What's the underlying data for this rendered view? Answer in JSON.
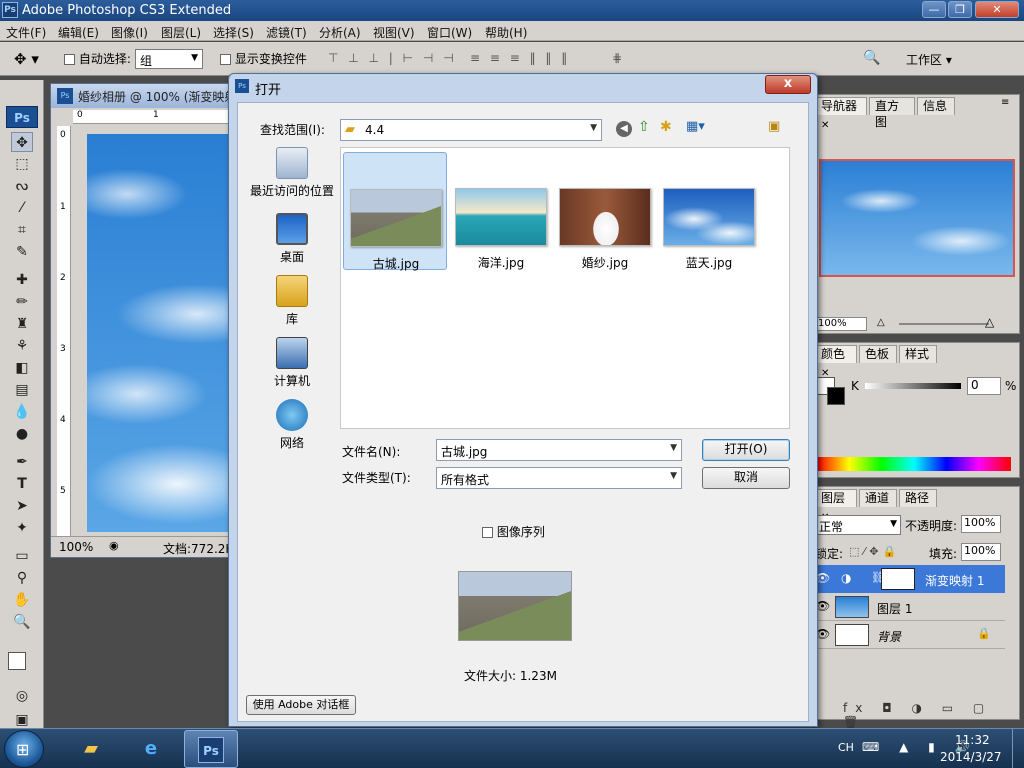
{
  "app": {
    "title": "Adobe Photoshop CS3 Extended",
    "ps_badge": "Ps"
  },
  "menu": [
    "文件(F)",
    "编辑(E)",
    "图像(I)",
    "图层(L)",
    "选择(S)",
    "滤镜(T)",
    "分析(A)",
    "视图(V)",
    "窗口(W)",
    "帮助(H)"
  ],
  "options_bar": {
    "auto_select_label": "自动选择:",
    "auto_select_value": "组",
    "show_transform_label": "显示变换控件",
    "workspace_label": "工作区 ▾"
  },
  "document": {
    "title": "婚纱相册 @ 100% (渐变映射",
    "zoom": "100%",
    "doc_size": "文档:772.2K",
    "ruler_top": [
      "0",
      "1"
    ],
    "ruler_left": [
      "0",
      "1",
      "2",
      "3",
      "4",
      "5"
    ]
  },
  "navigator_panel": {
    "tabs": [
      "导航器",
      "直方图",
      "信息"
    ],
    "zoom": "100%"
  },
  "color_panel": {
    "tabs": [
      "颜色",
      "色板",
      "样式"
    ],
    "channel": "K",
    "value": "0",
    "unit": "%"
  },
  "layers_panel": {
    "tabs": [
      "图层",
      "通道",
      "路径"
    ],
    "blend_mode": "正常",
    "opacity_label": "不透明度:",
    "opacity": "100%",
    "lock_label": "锁定:",
    "fill_label": "填充:",
    "fill": "100%",
    "layers": [
      {
        "name": "渐变映射 1",
        "selected": true
      },
      {
        "name": "图层 1",
        "selected": false
      },
      {
        "name": "背景",
        "selected": false
      }
    ]
  },
  "dialog": {
    "title": "打开",
    "look_in_label": "查找范围(I):",
    "look_in_value": "4.4",
    "places": [
      "最近访问的位置",
      "桌面",
      "库",
      "计算机",
      "网络"
    ],
    "files": [
      {
        "name": "古城.jpg",
        "selected": true
      },
      {
        "name": "海洋.jpg",
        "selected": false
      },
      {
        "name": "婚纱.jpg",
        "selected": false
      },
      {
        "name": "蓝天.jpg",
        "selected": false
      }
    ],
    "filename_label": "文件名(N):",
    "filename_value": "古城.jpg",
    "filetype_label": "文件类型(T):",
    "filetype_value": "所有格式",
    "open_button": "打开(O)",
    "cancel_button": "取消",
    "image_sequence_label": "图像序列",
    "file_size": "文件大小: 1.23M",
    "adobe_dialog_button": "使用 Adobe 对话框",
    "close_button": "x"
  },
  "taskbar": {
    "lang": "CH",
    "time": "11:32",
    "date": "2014/3/27",
    "ps_label": "Ps"
  },
  "colors": {
    "title_blue": "#2c5d9b",
    "panel_gray": "#d6d3ce",
    "layer_selected": "#3b78d8"
  }
}
